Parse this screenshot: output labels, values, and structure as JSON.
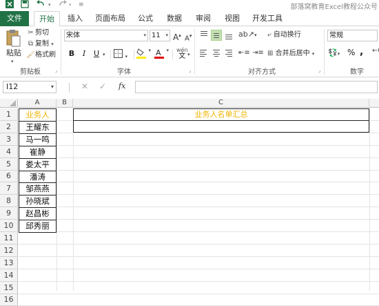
{
  "title": "部落窝教育Excel教程公众号",
  "tabs": [
    "文件",
    "开始",
    "插入",
    "页面布局",
    "公式",
    "数据",
    "审阅",
    "视图",
    "开发工具"
  ],
  "active_tab": "开始",
  "clipboard": {
    "paste_label": "粘贴",
    "cut_label": "剪切",
    "copy_label": "复制",
    "format_painter_label": "格式刷",
    "group_label": "剪贴板"
  },
  "font": {
    "font_name": "宋体",
    "font_size": "11",
    "grow_label": "A",
    "shrink_label": "A",
    "bold": "B",
    "italic": "I",
    "underline": "U",
    "fill_color": "#ffeb00",
    "font_color": "#e00000",
    "phonetic_label": "wén",
    "group_label": "字体"
  },
  "alignment": {
    "wrap_text_label": "自动换行",
    "merge_center_label": "合并后居中",
    "group_label": "对齐方式"
  },
  "number": {
    "format": "常规",
    "percent": "%",
    "comma": ",",
    "group_label": "数字"
  },
  "formula_bar": {
    "name_box": "I12",
    "cancel": "✕",
    "enter": "✓",
    "fx": "fx",
    "value": ""
  },
  "columns": [
    "A",
    "B",
    "C"
  ],
  "rows": [
    "1",
    "2",
    "3",
    "4",
    "5",
    "6",
    "7",
    "8",
    "9",
    "10",
    "11",
    "12",
    "13",
    "14",
    "15",
    "16"
  ],
  "cells": {
    "A": [
      "业务人",
      "王耀东",
      "马一鸣",
      "崔静",
      "娄太平",
      "潘涛",
      "邹燕燕",
      "孙晓斌",
      "赵昌彬",
      "邱秀丽"
    ],
    "C1": "业务人名单汇总",
    "C2": ""
  },
  "colors": {
    "header_text": "#f0b400",
    "excel_green": "#217346"
  }
}
